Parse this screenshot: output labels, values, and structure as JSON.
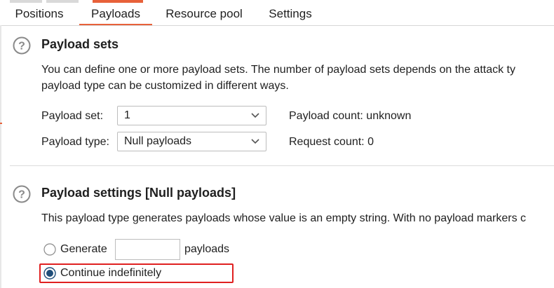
{
  "tabs": [
    {
      "label": "Positions"
    },
    {
      "label": "Payloads",
      "active": true
    },
    {
      "label": "Resource pool"
    },
    {
      "label": "Settings"
    }
  ],
  "payload_sets": {
    "title": "Payload sets",
    "description_line1": "You can define one or more payload sets. The number of payload sets depends on the attack ty",
    "description_line2": "payload type can be customized in different ways.",
    "set_label": "Payload set:",
    "set_value": "1",
    "type_label": "Payload type:",
    "type_value": "Null payloads",
    "payload_count": "Payload count: unknown",
    "request_count": "Request count: 0"
  },
  "payload_settings": {
    "title": "Payload settings [Null payloads]",
    "description": "This payload type generates payloads whose value is an empty string. With no payload markers c",
    "generate_label": "Generate",
    "generate_value": "",
    "payloads_label": "payloads",
    "continue_label": "Continue indefinitely",
    "selected_option": "continue"
  },
  "colors": {
    "accent": "#e8613a",
    "highlight": "#e02020",
    "radio_selected": "#1f4e79"
  }
}
